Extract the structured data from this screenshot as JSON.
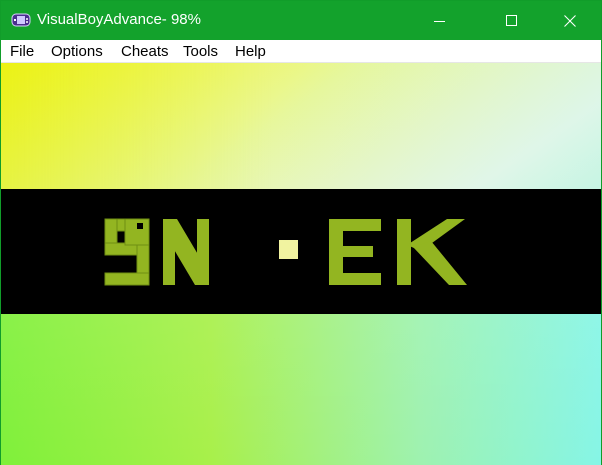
{
  "window": {
    "title": "VisualBoyAdvance- 98%",
    "titlebar_color": "#13a22c",
    "icon": "gameboy-advance-icon"
  },
  "menu": {
    "items": [
      {
        "label": "File"
      },
      {
        "label": "Options"
      },
      {
        "label": "Cheats"
      },
      {
        "label": "Tools"
      },
      {
        "label": "Help"
      }
    ]
  },
  "game": {
    "logo_text": "SN·EK",
    "logo_color": "#93b521",
    "dot_color": "#f1f3a0",
    "band_color": "#000000"
  }
}
